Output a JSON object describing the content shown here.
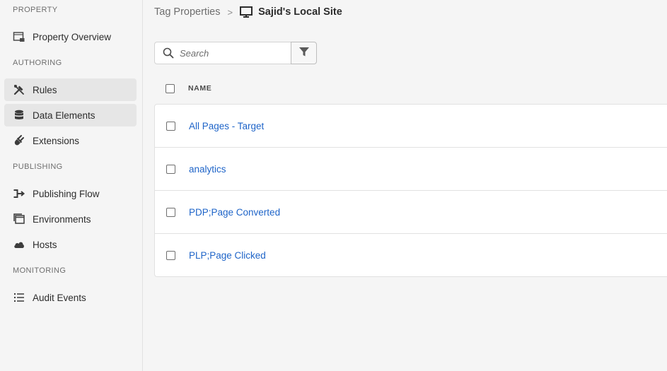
{
  "sidebar": {
    "sections": {
      "property": "PROPERTY",
      "authoring": "AUTHORING",
      "publishing": "PUBLISHING",
      "monitoring": "MONITORING"
    },
    "items": {
      "property_overview": "Property Overview",
      "rules": "Rules",
      "data_elements": "Data Elements",
      "extensions": "Extensions",
      "publishing_flow": "Publishing Flow",
      "environments": "Environments",
      "hosts": "Hosts",
      "audit_events": "Audit Events"
    },
    "icons": {
      "property_overview": "property-overview-icon",
      "rules": "rules-tools-icon",
      "data_elements": "database-icon",
      "extensions": "plug-icon",
      "publishing_flow": "publishing-flow-icon",
      "environments": "environments-icon",
      "hosts": "cloud-icon",
      "audit_events": "list-icon"
    }
  },
  "breadcrumb": {
    "parent": "Tag Properties",
    "separator": ">",
    "current": "Sajid's Local Site",
    "current_icon": "monitor-icon"
  },
  "search": {
    "placeholder": "Search",
    "value": "",
    "icon": "search-icon",
    "filter_icon": "filter-icon"
  },
  "table": {
    "columns": [
      "NAME"
    ],
    "rows": [
      {
        "name": "All Pages - Target"
      },
      {
        "name": "analytics"
      },
      {
        "name": "PDP;Page Converted"
      },
      {
        "name": "PLP;Page Clicked"
      }
    ]
  },
  "colors": {
    "link": "#1e64c8",
    "active_nav_bg": "#e6e6e6",
    "background": "#f5f5f5"
  }
}
